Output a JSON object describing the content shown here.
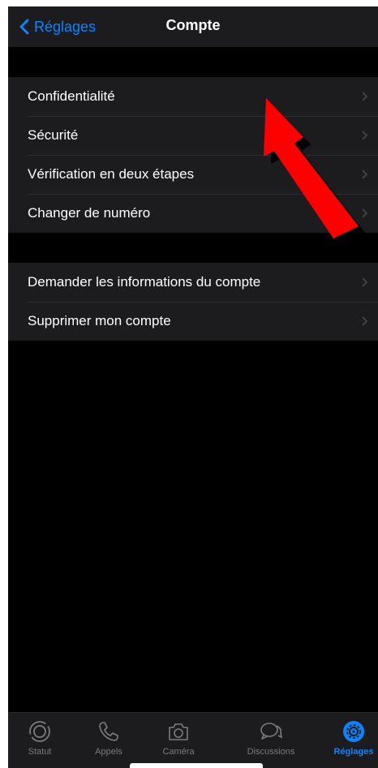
{
  "header": {
    "back_label": "Réglages",
    "title": "Compte"
  },
  "groups": [
    {
      "items": [
        {
          "label": "Confidentialité"
        },
        {
          "label": "Sécurité"
        },
        {
          "label": "Vérification en deux étapes"
        },
        {
          "label": "Changer de numéro"
        }
      ]
    },
    {
      "items": [
        {
          "label": "Demander les informations du compte"
        },
        {
          "label": "Supprimer mon compte"
        }
      ]
    }
  ],
  "tabbar": {
    "tabs": [
      {
        "label": "Statut",
        "icon": "status-icon"
      },
      {
        "label": "Appels",
        "icon": "phone-icon"
      },
      {
        "label": "Caméra",
        "icon": "camera-icon"
      },
      {
        "label": "Discussions",
        "icon": "chat-bubbles-icon"
      },
      {
        "label": "Réglages",
        "icon": "gear-icon",
        "active": true
      }
    ]
  },
  "colors": {
    "accent": "#0a84ff",
    "background": "#000000",
    "cell": "#1c1c1e",
    "annotation_arrow": "#ff0000"
  }
}
